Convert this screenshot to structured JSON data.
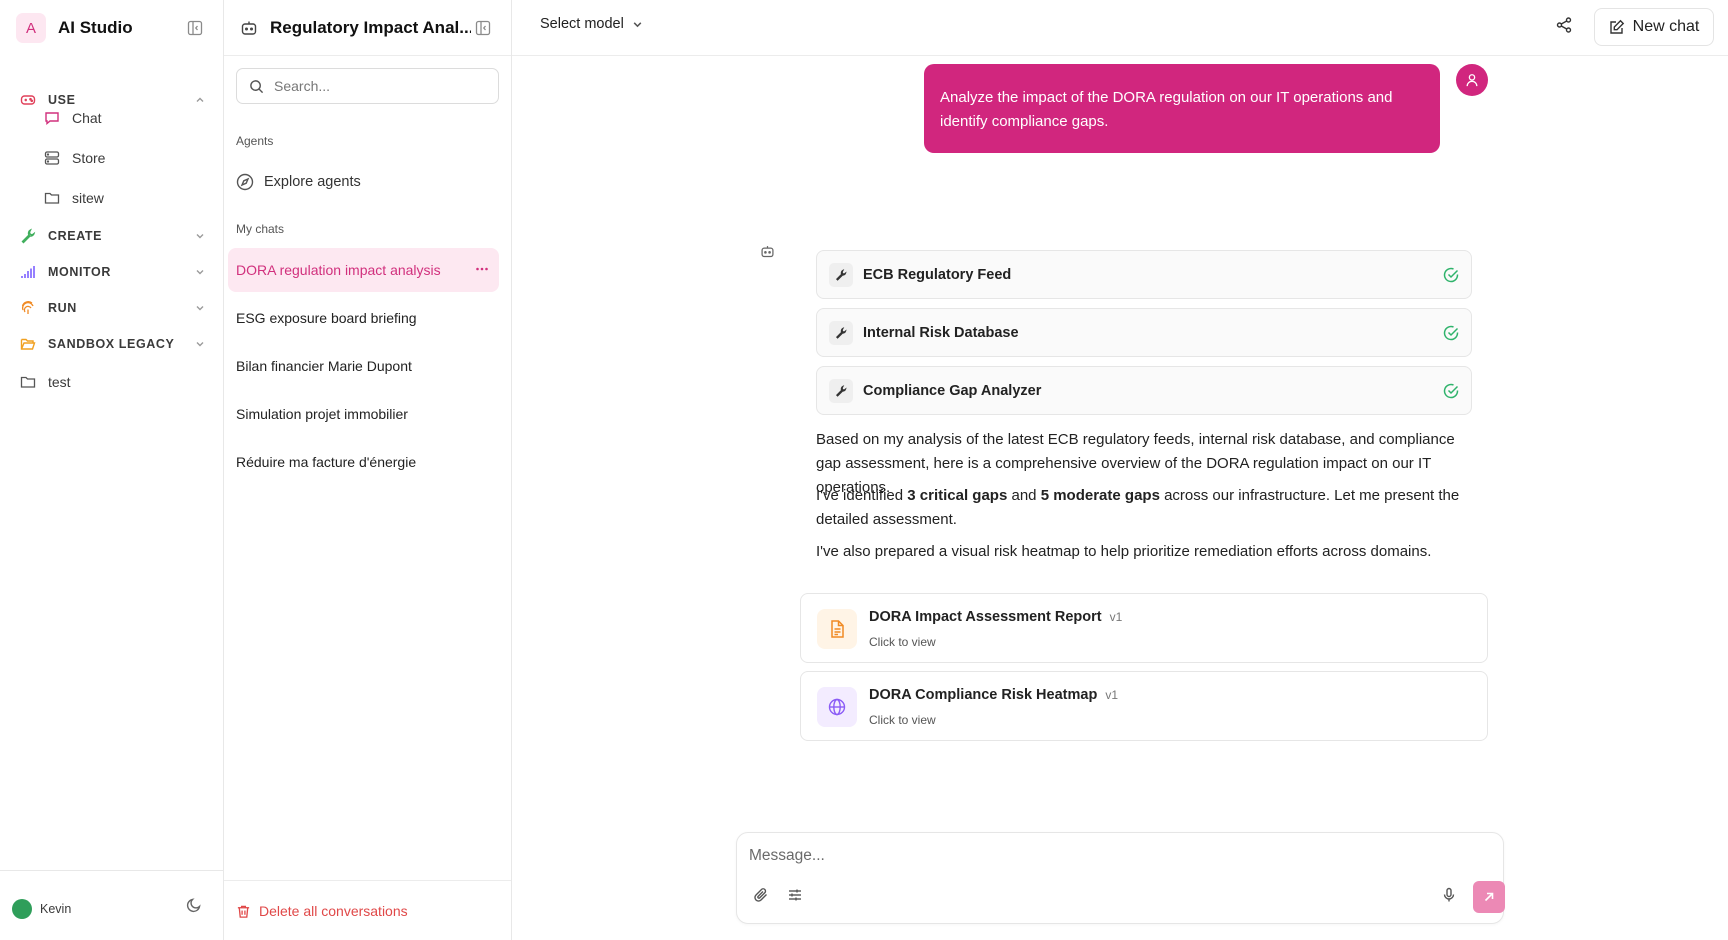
{
  "colors": {
    "accent": "#d1267e",
    "accent_soft": "#fde8f1",
    "success": "#2fb36b",
    "danger": "#e04848"
  },
  "sidebar": {
    "app_initial": "A",
    "app_title": "AI Studio",
    "sections": {
      "use": "USE",
      "create": "CREATE",
      "monitor": "MONITOR",
      "run": "RUN",
      "sandbox": "SANDBOX LEGACY"
    },
    "use_items": [
      "Chat",
      "Store",
      "sitew"
    ],
    "folder_test": "test",
    "user_name": "Kevin"
  },
  "chats_panel": {
    "title": "Regulatory Impact Anal...",
    "search_placeholder": "Search...",
    "agents_label": "Agents",
    "explore_label": "Explore agents",
    "my_chats_label": "My chats",
    "chats": [
      "DORA regulation impact analysis",
      "ESG exposure board briefing",
      "Bilan financier Marie Dupont",
      "Simulation projet immobilier",
      "Réduire ma facture d'énergie"
    ],
    "delete_all": "Delete all conversations"
  },
  "header": {
    "model_select": "Select model",
    "new_chat": "New chat"
  },
  "conversation": {
    "user_message": "Analyze the impact of the DORA regulation on our IT operations and identify compliance gaps.",
    "tools": [
      "ECB Regulatory Feed",
      "Internal Risk Database",
      "Compliance Gap Analyzer"
    ],
    "answer": {
      "p1": "Based on my analysis of the latest ECB regulatory feeds, internal risk database, and compliance gap assessment, here is a comprehensive overview of the DORA regulation impact on our IT operations.",
      "p2_a": "I've identified ",
      "p2_b": "3 critical gaps",
      "p2_c": " and ",
      "p2_d": "5 moderate gaps",
      "p2_e": " across our infrastructure. Let me present the detailed assessment.",
      "p3": "I've also prepared a visual risk heatmap to help prioritize remediation efforts across domains."
    },
    "artifacts": [
      {
        "title": "DORA Impact Assessment Report",
        "version": "v1",
        "subtitle": "Click to view",
        "icon": "document-icon"
      },
      {
        "title": "DORA Compliance Risk Heatmap",
        "version": "v1",
        "subtitle": "Click to view",
        "icon": "globe-icon"
      }
    ]
  },
  "composer": {
    "placeholder": "Message..."
  }
}
